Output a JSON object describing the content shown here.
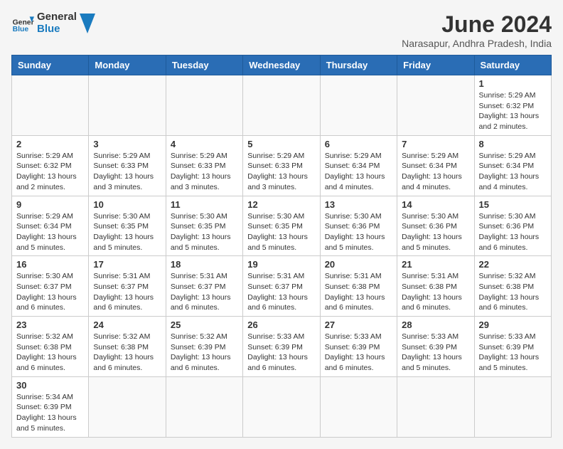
{
  "logo": {
    "text_general": "General",
    "text_blue": "Blue"
  },
  "title": "June 2024",
  "subtitle": "Narasapur, Andhra Pradesh, India",
  "days_of_week": [
    "Sunday",
    "Monday",
    "Tuesday",
    "Wednesday",
    "Thursday",
    "Friday",
    "Saturday"
  ],
  "weeks": [
    [
      {
        "day": null,
        "info": null
      },
      {
        "day": null,
        "info": null
      },
      {
        "day": null,
        "info": null
      },
      {
        "day": null,
        "info": null
      },
      {
        "day": null,
        "info": null
      },
      {
        "day": null,
        "info": null
      },
      {
        "day": "1",
        "info": "Sunrise: 5:29 AM\nSunset: 6:32 PM\nDaylight: 13 hours and 2 minutes."
      }
    ],
    [
      {
        "day": "2",
        "info": "Sunrise: 5:29 AM\nSunset: 6:32 PM\nDaylight: 13 hours and 2 minutes."
      },
      {
        "day": "3",
        "info": "Sunrise: 5:29 AM\nSunset: 6:33 PM\nDaylight: 13 hours and 3 minutes."
      },
      {
        "day": "4",
        "info": "Sunrise: 5:29 AM\nSunset: 6:33 PM\nDaylight: 13 hours and 3 minutes."
      },
      {
        "day": "5",
        "info": "Sunrise: 5:29 AM\nSunset: 6:33 PM\nDaylight: 13 hours and 3 minutes."
      },
      {
        "day": "6",
        "info": "Sunrise: 5:29 AM\nSunset: 6:34 PM\nDaylight: 13 hours and 4 minutes."
      },
      {
        "day": "7",
        "info": "Sunrise: 5:29 AM\nSunset: 6:34 PM\nDaylight: 13 hours and 4 minutes."
      },
      {
        "day": "8",
        "info": "Sunrise: 5:29 AM\nSunset: 6:34 PM\nDaylight: 13 hours and 4 minutes."
      }
    ],
    [
      {
        "day": "9",
        "info": "Sunrise: 5:29 AM\nSunset: 6:34 PM\nDaylight: 13 hours and 5 minutes."
      },
      {
        "day": "10",
        "info": "Sunrise: 5:30 AM\nSunset: 6:35 PM\nDaylight: 13 hours and 5 minutes."
      },
      {
        "day": "11",
        "info": "Sunrise: 5:30 AM\nSunset: 6:35 PM\nDaylight: 13 hours and 5 minutes."
      },
      {
        "day": "12",
        "info": "Sunrise: 5:30 AM\nSunset: 6:35 PM\nDaylight: 13 hours and 5 minutes."
      },
      {
        "day": "13",
        "info": "Sunrise: 5:30 AM\nSunset: 6:36 PM\nDaylight: 13 hours and 5 minutes."
      },
      {
        "day": "14",
        "info": "Sunrise: 5:30 AM\nSunset: 6:36 PM\nDaylight: 13 hours and 5 minutes."
      },
      {
        "day": "15",
        "info": "Sunrise: 5:30 AM\nSunset: 6:36 PM\nDaylight: 13 hours and 6 minutes."
      }
    ],
    [
      {
        "day": "16",
        "info": "Sunrise: 5:30 AM\nSunset: 6:37 PM\nDaylight: 13 hours and 6 minutes."
      },
      {
        "day": "17",
        "info": "Sunrise: 5:31 AM\nSunset: 6:37 PM\nDaylight: 13 hours and 6 minutes."
      },
      {
        "day": "18",
        "info": "Sunrise: 5:31 AM\nSunset: 6:37 PM\nDaylight: 13 hours and 6 minutes."
      },
      {
        "day": "19",
        "info": "Sunrise: 5:31 AM\nSunset: 6:37 PM\nDaylight: 13 hours and 6 minutes."
      },
      {
        "day": "20",
        "info": "Sunrise: 5:31 AM\nSunset: 6:38 PM\nDaylight: 13 hours and 6 minutes."
      },
      {
        "day": "21",
        "info": "Sunrise: 5:31 AM\nSunset: 6:38 PM\nDaylight: 13 hours and 6 minutes."
      },
      {
        "day": "22",
        "info": "Sunrise: 5:32 AM\nSunset: 6:38 PM\nDaylight: 13 hours and 6 minutes."
      }
    ],
    [
      {
        "day": "23",
        "info": "Sunrise: 5:32 AM\nSunset: 6:38 PM\nDaylight: 13 hours and 6 minutes."
      },
      {
        "day": "24",
        "info": "Sunrise: 5:32 AM\nSunset: 6:38 PM\nDaylight: 13 hours and 6 minutes."
      },
      {
        "day": "25",
        "info": "Sunrise: 5:32 AM\nSunset: 6:39 PM\nDaylight: 13 hours and 6 minutes."
      },
      {
        "day": "26",
        "info": "Sunrise: 5:33 AM\nSunset: 6:39 PM\nDaylight: 13 hours and 6 minutes."
      },
      {
        "day": "27",
        "info": "Sunrise: 5:33 AM\nSunset: 6:39 PM\nDaylight: 13 hours and 6 minutes."
      },
      {
        "day": "28",
        "info": "Sunrise: 5:33 AM\nSunset: 6:39 PM\nDaylight: 13 hours and 5 minutes."
      },
      {
        "day": "29",
        "info": "Sunrise: 5:33 AM\nSunset: 6:39 PM\nDaylight: 13 hours and 5 minutes."
      }
    ],
    [
      {
        "day": "30",
        "info": "Sunrise: 5:34 AM\nSunset: 6:39 PM\nDaylight: 13 hours and 5 minutes."
      },
      {
        "day": null,
        "info": null
      },
      {
        "day": null,
        "info": null
      },
      {
        "day": null,
        "info": null
      },
      {
        "day": null,
        "info": null
      },
      {
        "day": null,
        "info": null
      },
      {
        "day": null,
        "info": null
      }
    ]
  ]
}
